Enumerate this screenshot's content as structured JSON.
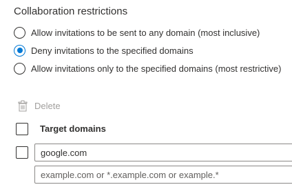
{
  "section": {
    "title": "Collaboration restrictions"
  },
  "radio_options": [
    {
      "label": "Allow invitations to be sent to any domain (most inclusive)",
      "checked": false
    },
    {
      "label": "Deny invitations to the specified domains",
      "checked": true
    },
    {
      "label": "Allow invitations only to the specified domains (most restrictive)",
      "checked": false
    }
  ],
  "toolbar": {
    "delete_label": "Delete",
    "delete_icon": "trash-icon",
    "delete_enabled": false
  },
  "table": {
    "header": "Target domains",
    "rows": [
      {
        "value": "google.com",
        "checked": false
      }
    ],
    "new_row": {
      "value": "",
      "placeholder": "example.com or *.example.com or example.*"
    }
  },
  "colors": {
    "accent": "#0078d4",
    "text": "#323130",
    "disabled_text": "#a19f9d"
  }
}
